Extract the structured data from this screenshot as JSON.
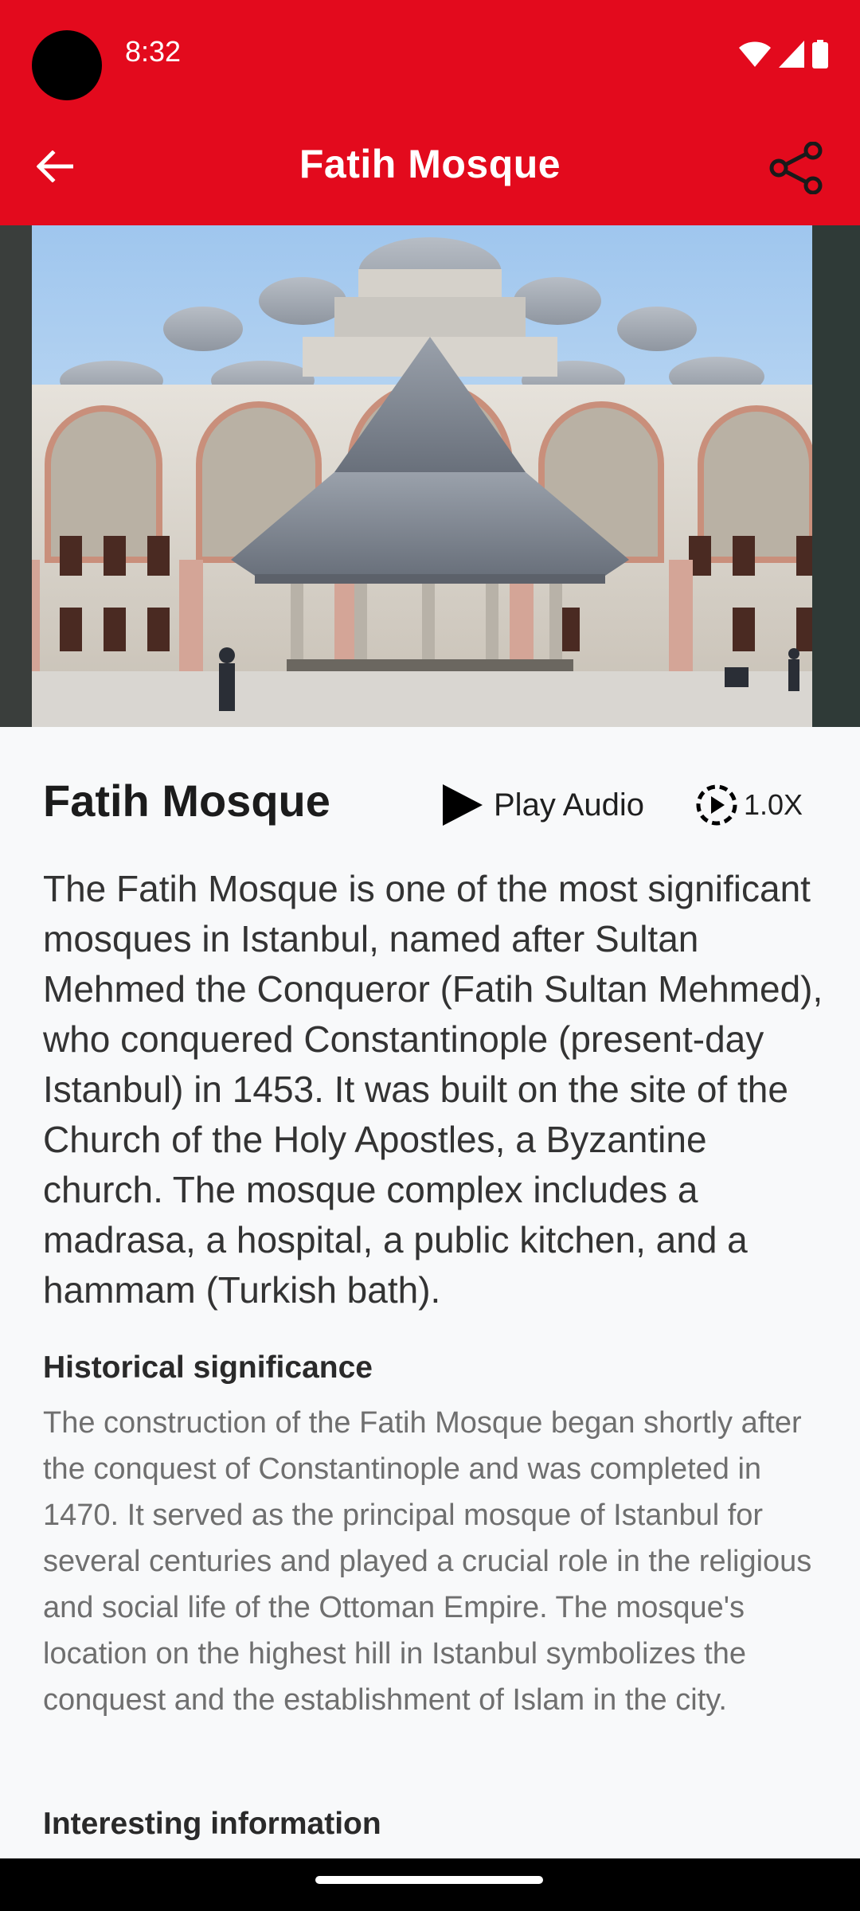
{
  "status_bar": {
    "time": "8:32",
    "icons": [
      "wifi-icon",
      "cellular-signal-icon",
      "battery-icon"
    ]
  },
  "app_bar": {
    "title": "Fatih Mosque",
    "back_icon": "arrow-back-icon",
    "share_icon": "share-icon",
    "background_color": "#e30a1d"
  },
  "hero_image": {
    "subject": "Fatih Mosque courtyard with domes, arcades and central ablution fountain"
  },
  "place": {
    "name": "Fatih Mosque",
    "play_audio_label": "Play Audio",
    "speed_label": "1.0X",
    "intro": "The Fatih Mosque is one of the most significant mosques in Istanbul, named after Sultan Mehmed the Conqueror (Fatih Sultan Mehmed), who conquered Constantinople (present-day Istanbul) in 1453. It was built on the site of the Church of the Holy Apostles, a Byzantine church. The mosque complex includes a madrasa, a hospital, a public kitchen, and a hammam (Turkish bath)."
  },
  "sections": [
    {
      "heading": "Historical significance",
      "body": "The construction of the Fatih Mosque began shortly after the conquest of Constantinople and was completed in 1470. It served as the principal mosque of Istanbul for several centuries and played a crucial role in the religious and social life of the Ottoman Empire. The mosque's location on the highest hill in Istanbul symbolizes the conquest and the establishment of Islam in the city."
    },
    {
      "heading": "Interesting information",
      "body": ""
    }
  ]
}
